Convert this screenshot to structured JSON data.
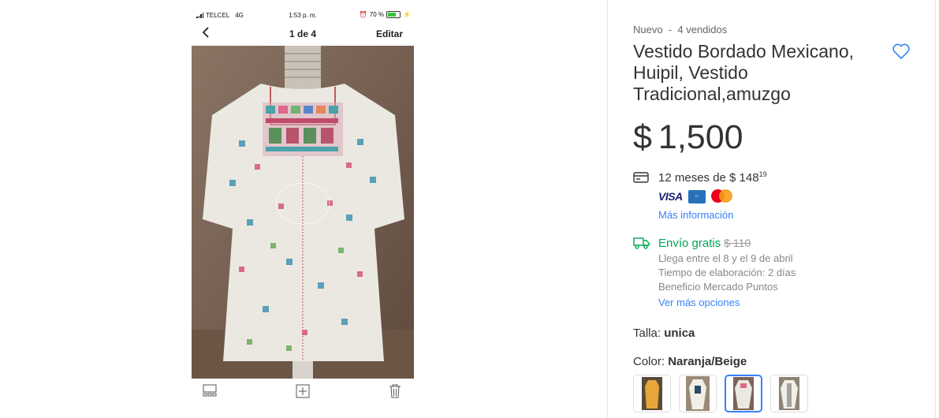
{
  "phone": {
    "carrier": "TELCEL",
    "network": "4G",
    "time": "1:53 p. m.",
    "battery_text": "70 %",
    "battery_level": 0.7,
    "counter": "1 de 4",
    "edit_label": "Editar"
  },
  "product": {
    "meta": "Nuevo  -  4 vendidos",
    "title": "Vestido Bordado Mexicano, Huipil, Vestido Tradicional,amuzgo",
    "price_currency": "$",
    "price_amount": "1,500",
    "installments_prefix": "12 meses de $ 148",
    "installments_cents": "19",
    "cards": {
      "visa": "VISA"
    },
    "more_info": "Más información",
    "shipping_title": "Envío gratis",
    "shipping_old_price": "$ 110",
    "shipping_lines": [
      "Llega entre el 8 y el 9 de abril",
      "Tiempo de elaboración: 2 días",
      "Beneficio Mercado Puntos"
    ],
    "more_options": "Ver más opciones",
    "size_label": "Talla:",
    "size_value": "unica",
    "color_label": "Color:",
    "color_value": "Naranja/Beige",
    "variant_count": 4,
    "selected_variant": 3
  },
  "colors": {
    "accent": "#3483fa",
    "shipping_green": "#00a650",
    "text": "#333333",
    "muted": "#888888"
  },
  "icons": [
    "chevron-left-icon",
    "grid-icon",
    "plus-square-icon",
    "trash-icon",
    "heart-icon",
    "credit-card-icon",
    "truck-icon"
  ]
}
